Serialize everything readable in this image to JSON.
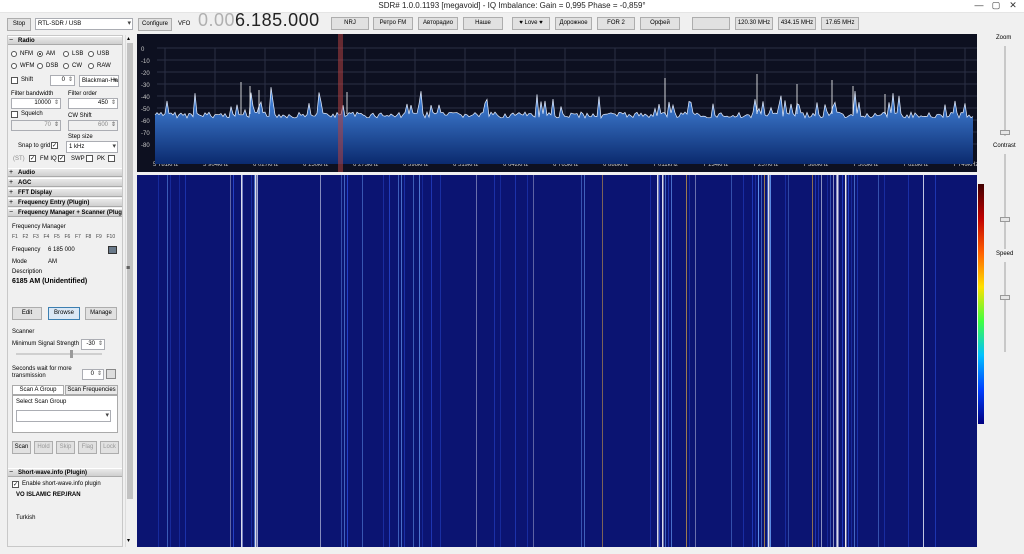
{
  "window": {
    "title": "SDR# 1.0.0.1193 [megavoid] - IQ Imbalance: Gain = 0,995 Phase = -0,859°",
    "min": "—",
    "max": "▢",
    "close": "✕"
  },
  "toolbar": {
    "stop_label": "Stop",
    "device": "RTL-SDR / USB",
    "configure_label": "Configure",
    "vfo_label": "VFO",
    "vfo_dim": "0.00",
    "vfo_value": "6.185.000",
    "presets": [
      "NRJ",
      "Ретро FM",
      "Авторадио",
      "Наше",
      "♥ Love ♥",
      "Дорожное",
      "FOR 2",
      "Орфей",
      "",
      "120.30 MHz",
      "434.15 MHz",
      "17.65 MHz"
    ]
  },
  "radio": {
    "header": "Radio",
    "modes": [
      "NFM",
      "AM",
      "LSB",
      "USB",
      "WFM",
      "DSB",
      "CW",
      "RAW"
    ],
    "selected_mode": "AM",
    "shift_label": "Shift",
    "shift_value": "0",
    "window": "Blackman-Har",
    "filter_bandwidth_label": "Filter bandwidth",
    "filter_bandwidth": "10000",
    "filter_order_label": "Filter order",
    "filter_order": "450",
    "squelch_label": "Squelch",
    "squelch_value": "70",
    "cw_shift_label": "CW Shift",
    "cw_shift_value": "600",
    "step_size_label": "Step size",
    "snap_label": "Snap to grid",
    "step_size": "1 kHz",
    "st_label": "(ST)",
    "fmiq_label": "FM IQ",
    "swap_label": "SWP",
    "pk_label": "PK"
  },
  "sections": [
    "Audio",
    "AGC",
    "FFT Display",
    "Frequency Entry (Plugin)",
    "Frequency Manager + Scanner (Plugin)"
  ],
  "fm": {
    "manager_label": "Frequency Manager",
    "fkeys": [
      "F1",
      "F2",
      "F3",
      "F4",
      "F5",
      "F6",
      "F7",
      "F8",
      "F9",
      "F10"
    ],
    "frequency_label": "Frequency",
    "frequency_value": "6 185 000",
    "mode_label": "Mode",
    "mode_value": "AM",
    "description_label": "Description",
    "description_value": "6185 AM (Unidentified)",
    "edit_label": "Edit",
    "browse_label": "Browse",
    "manage_label": "Manage",
    "scanner_label": "Scanner",
    "min_signal_label": "Minimum Signal Strength",
    "min_signal_value": "-30",
    "seconds_wait_label": "Seconds wait for more transmission",
    "seconds_wait_value": "0",
    "tab_a": "Scan A Group",
    "tab_b": "Scan Frequencies",
    "select_group_label": "Select Scan Group",
    "scan_buttons": [
      "Scan",
      "Hold",
      "Skip",
      "Flag",
      "Lock"
    ]
  },
  "shortwave": {
    "header": "Short-wave.info (Plugin)",
    "enable_label": "Enable short-wave.info plugin",
    "station": "VO ISLAMIC REP.IRAN",
    "language": "Turkish"
  },
  "spectrum": {
    "db_labels": [
      "0",
      "-10",
      "-20",
      "-30",
      "-40",
      "-50",
      "-60",
      "-70",
      "-80"
    ],
    "freq_labels": [
      "5 781kHz",
      "5 904kHz",
      "6 027kHz",
      "6 150kHz",
      "6 273kHz",
      "6 396kHz",
      "6 519kHz",
      "6 642kHz",
      "6 765kHz",
      "6 888kHz",
      "7 011kHz",
      "7 134kHz",
      "7 257kHz",
      "7 380kHz",
      "7 503kHz",
      "7 626kHz",
      "7 749kHz"
    ]
  },
  "right": {
    "zoom_label": "Zoom",
    "contrast_label": "Contrast",
    "speed_label": "Speed"
  },
  "colors": {
    "spectrum_fill": "#1f5fc0",
    "waterfall_bg": "#0b1472",
    "vfo_marker": "#b04040"
  }
}
